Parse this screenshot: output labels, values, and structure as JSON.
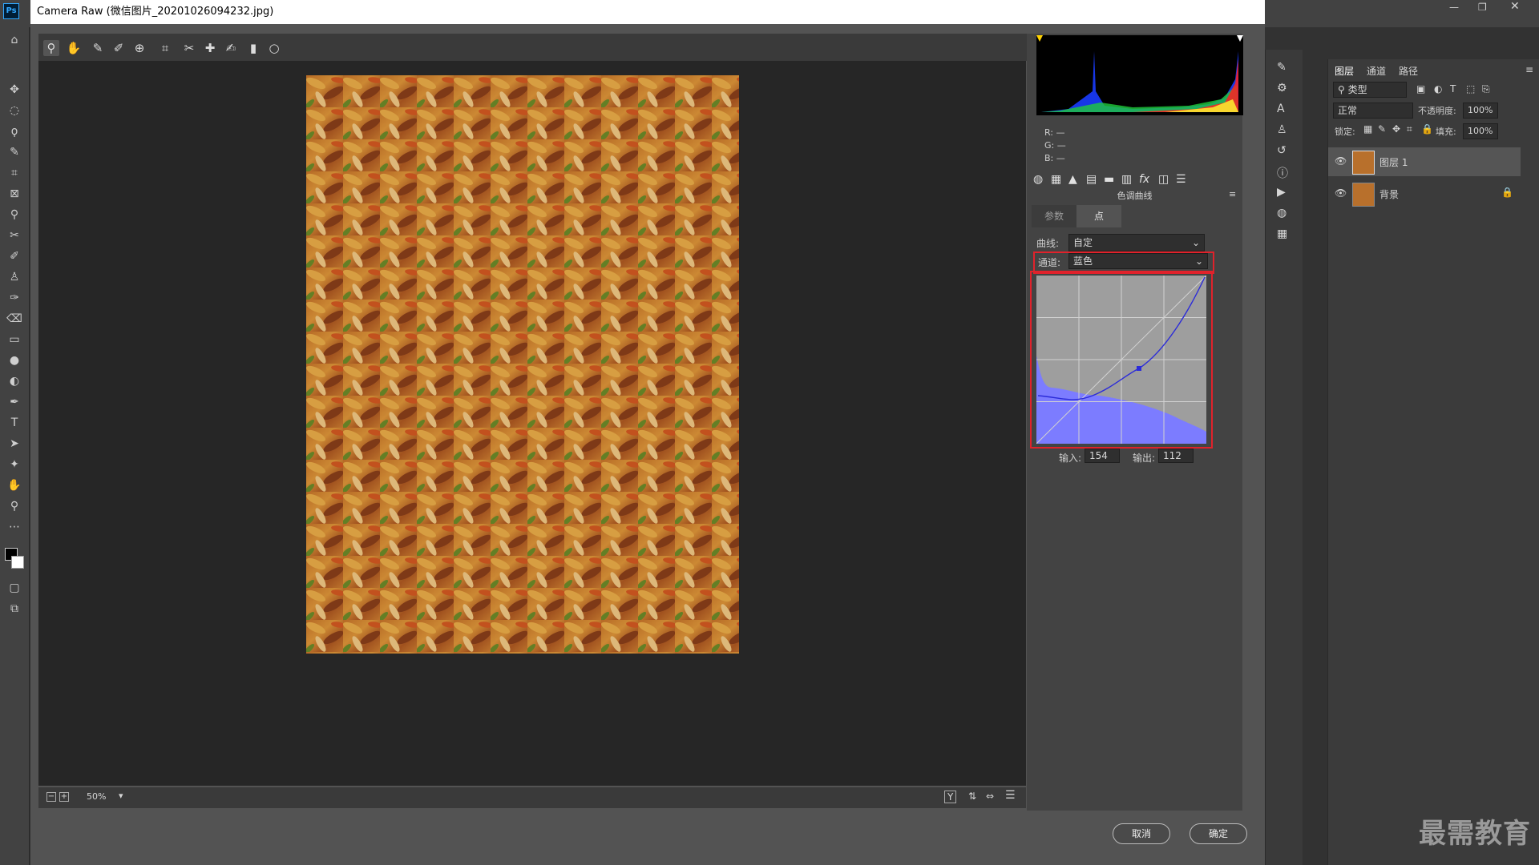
{
  "window": {
    "title": "Camera Raw (微信图片_20201026094232.jpg)"
  },
  "cr_toolbar": {
    "tools": [
      "zoom-icon",
      "hand-icon",
      "white-balance-icon",
      "color-sampler-icon",
      "targeted-adjust-icon",
      "crop-icon",
      "straighten-icon",
      "spot-removal-icon",
      "red-eye-icon",
      "adjustment-brush-icon",
      "graduated-filter-icon",
      "radial-filter-icon"
    ]
  },
  "histogram": {
    "r_label": "R:",
    "g_label": "G:",
    "b_label": "B:",
    "r_value": "—",
    "g_value": "—",
    "b_value": "—"
  },
  "panel": {
    "title": "色调曲线",
    "tabs": [
      "参数",
      "点"
    ],
    "curve_label": "曲线:",
    "curve_value": "自定",
    "channel_label": "通道:",
    "channel_value": "蓝色",
    "input_label": "输入:",
    "input_value": "154",
    "output_label": "输出:",
    "output_value": "112"
  },
  "bottom": {
    "zoom": "50%",
    "cancel": "取消",
    "ok": "确定"
  },
  "layers_panel": {
    "tabs": [
      "图层",
      "通道",
      "路径"
    ],
    "filter": "类型",
    "blend_mode": "正常",
    "opacity_label": "不透明度:",
    "opacity_value": "100%",
    "lock_label": "锁定:",
    "fill_label": "填充:",
    "fill_value": "100%",
    "layers": [
      {
        "name": "图层 1"
      },
      {
        "name": "背景"
      }
    ]
  },
  "watermark": "最需教育",
  "colors": {
    "accent_red": "#e0222b",
    "curve_blue": "#2b2bd9",
    "hist_fill": "#7c7cff"
  }
}
